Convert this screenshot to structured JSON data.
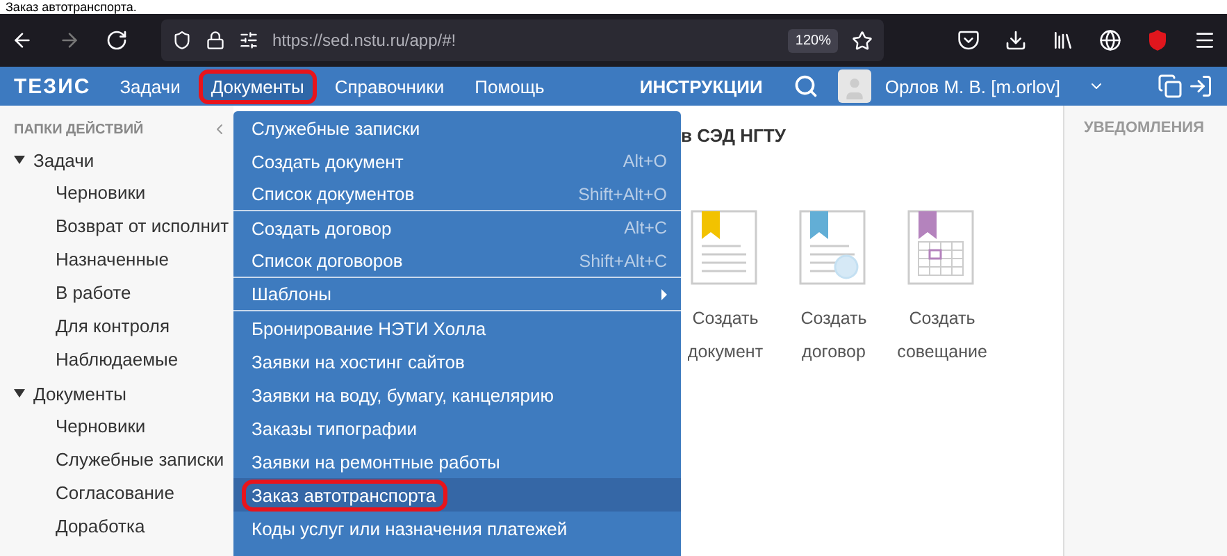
{
  "caption": "Заказ автотранспорта.",
  "browser": {
    "url": "https://sed.nstu.ru/app/#!",
    "zoom": "120%"
  },
  "header": {
    "logo": "ТЕЗИС",
    "nav": [
      {
        "label": "Задачи",
        "selected": false,
        "highlighted": false
      },
      {
        "label": "Документы",
        "selected": true,
        "highlighted": true
      },
      {
        "label": "Справочники",
        "selected": false,
        "highlighted": false
      },
      {
        "label": "Помощь",
        "selected": false,
        "highlighted": false
      }
    ],
    "instructions": "ИНСТРУКЦИИ",
    "user": "Орлов М. В. [m.orlov]"
  },
  "sidebar": {
    "title": "ПАПКИ ДЕЙСТВИЙ",
    "groups": [
      {
        "label": "Задачи",
        "expanded": true,
        "children": [
          {
            "label": "Черновики"
          },
          {
            "label": "Возврат от исполнит"
          },
          {
            "label": "Назначенные"
          },
          {
            "label": "В работе"
          },
          {
            "label": "Для контроля"
          },
          {
            "label": "Наблюдаемые"
          }
        ]
      },
      {
        "label": "Документы",
        "expanded": true,
        "children": [
          {
            "label": "Черновики"
          },
          {
            "label": "Служебные записки"
          },
          {
            "label": "Согласование"
          },
          {
            "label": "Доработка"
          }
        ]
      }
    ]
  },
  "main": {
    "title": "в СЭД НГТУ",
    "actions": [
      {
        "kind": "document",
        "line1": "Создать",
        "line2": "документ",
        "color": "#f2c200"
      },
      {
        "kind": "contract",
        "line1": "Создать",
        "line2": "договор",
        "color": "#62aed6"
      },
      {
        "kind": "meeting",
        "line1": "Создать",
        "line2": "совещание",
        "color": "#b483bd"
      }
    ]
  },
  "notifications": {
    "title": "УВЕДОМЛЕНИЯ"
  },
  "menu": [
    {
      "label": "Служебные записки",
      "selected": false,
      "highlighted": false,
      "separator_after": false
    },
    {
      "label": "Создать документ",
      "shortcut": "Alt+O",
      "selected": false,
      "highlighted": false,
      "separator_after": false
    },
    {
      "label": "Список документов",
      "shortcut": "Shift+Alt+O",
      "selected": false,
      "highlighted": false,
      "separator_after": true
    },
    {
      "label": "Создать договор",
      "shortcut": "Alt+C",
      "selected": false,
      "highlighted": false,
      "separator_after": false
    },
    {
      "label": "Список договоров",
      "shortcut": "Shift+Alt+C",
      "selected": false,
      "highlighted": false,
      "separator_after": true
    },
    {
      "label": "Шаблоны",
      "submenu": true,
      "selected": false,
      "highlighted": false,
      "separator_after": true
    },
    {
      "label": "Бронирование НЭТИ Холла",
      "selected": false,
      "highlighted": false,
      "separator_after": false
    },
    {
      "label": "Заявки на хостинг сайтов",
      "selected": false,
      "highlighted": false,
      "separator_after": false
    },
    {
      "label": "Заявки на воду, бумагу, канцелярию",
      "selected": false,
      "highlighted": false,
      "separator_after": false
    },
    {
      "label": "Заказы типографии",
      "selected": false,
      "highlighted": false,
      "separator_after": false
    },
    {
      "label": "Заявки на ремонтные работы",
      "selected": false,
      "highlighted": false,
      "separator_after": false
    },
    {
      "label": "Заказ автотранспорта",
      "selected": true,
      "highlighted": true,
      "separator_after": false
    },
    {
      "label": "Коды услуг или назначения платежей",
      "selected": false,
      "highlighted": false,
      "separator_after": false
    }
  ]
}
